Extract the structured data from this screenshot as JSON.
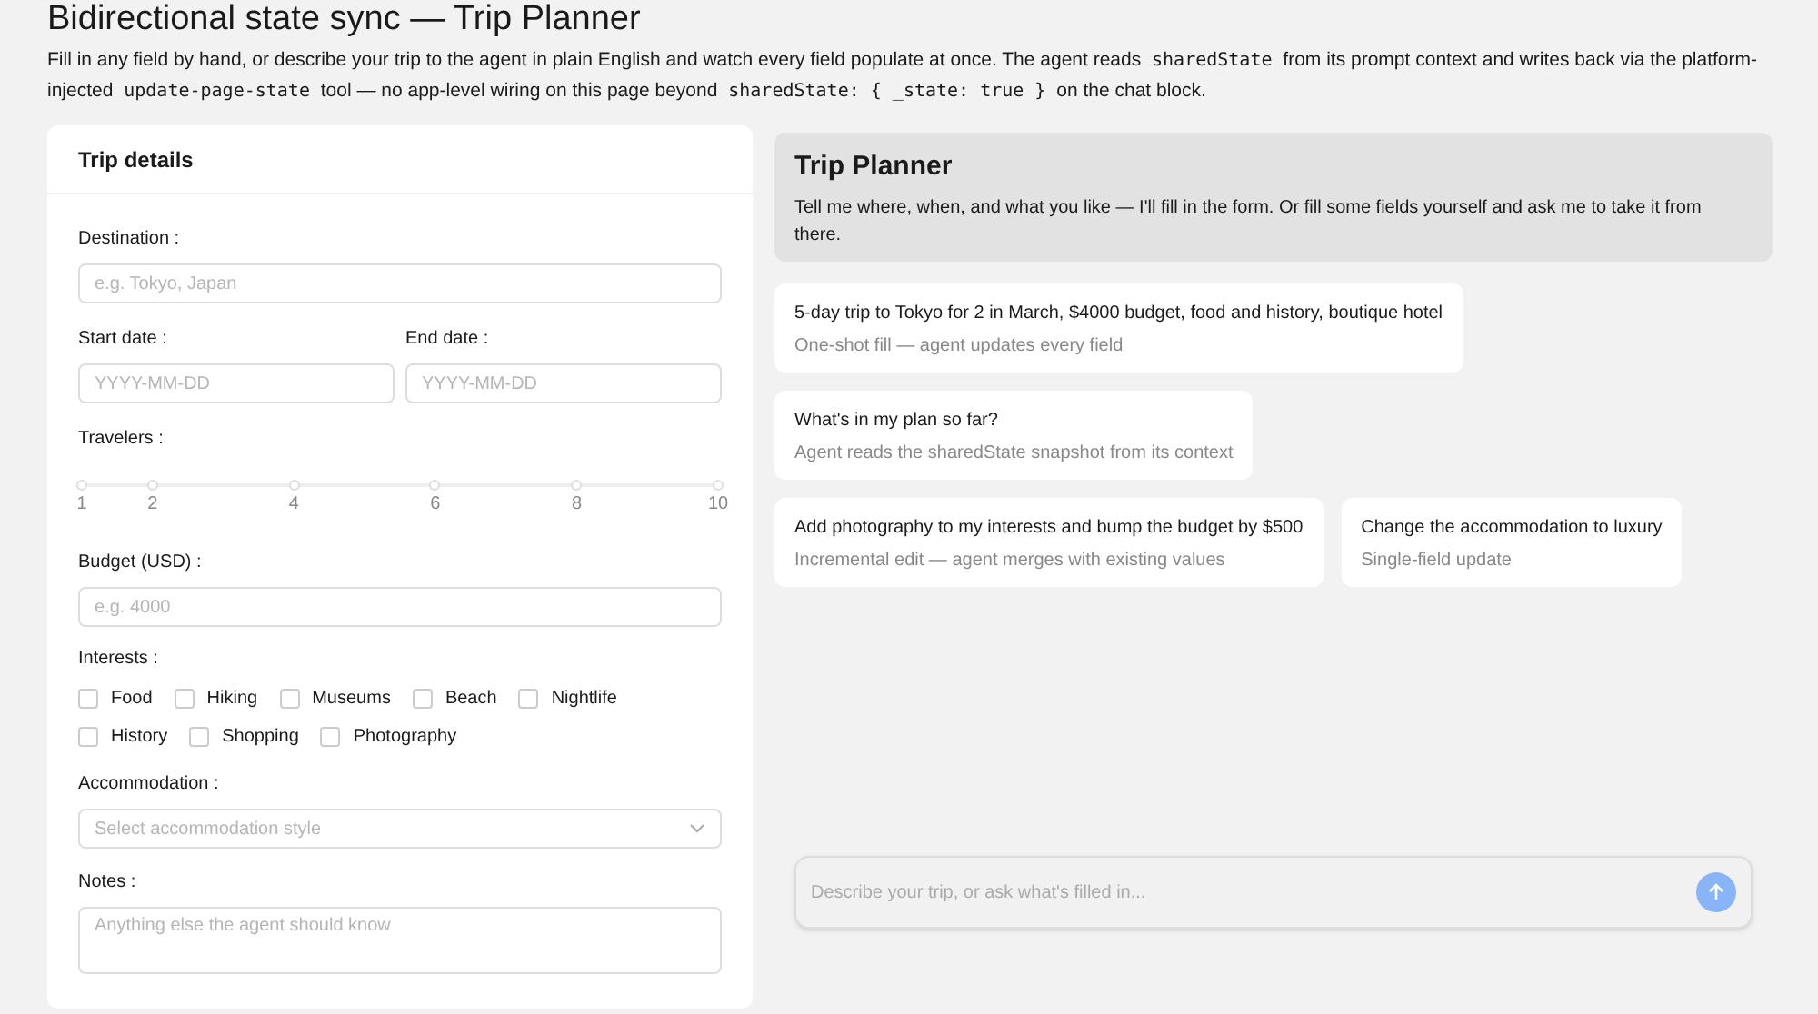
{
  "page": {
    "title": "Bidirectional state sync — Trip Planner",
    "intro_lines": [
      [
        {
          "kind": "text",
          "text": "Fill in any field by hand, or describe your trip to the agent in plain English and watch every field populate at once. The agent reads "
        },
        {
          "kind": "code",
          "text": "sharedState"
        },
        {
          "kind": "text",
          "text": " from its prompt context and writes back via the platform-"
        }
      ],
      [
        {
          "kind": "text",
          "text": "injected "
        },
        {
          "kind": "code",
          "text": "update-page-state"
        },
        {
          "kind": "text",
          "text": " tool — no app-level wiring on this page beyond "
        },
        {
          "kind": "code",
          "text": "sharedState: { _state: true }"
        },
        {
          "kind": "text",
          "text": " on the chat block."
        }
      ]
    ]
  },
  "form": {
    "title": "Trip details",
    "destination": {
      "label": "Destination :",
      "placeholder": "e.g. Tokyo, Japan"
    },
    "start_date": {
      "label": "Start date :",
      "placeholder": "YYYY-MM-DD"
    },
    "end_date": {
      "label": "End date :",
      "placeholder": "YYYY-MM-DD"
    },
    "travelers": {
      "label": "Travelers :",
      "ticks": [
        "1",
        "2",
        "4",
        "6",
        "8",
        "10"
      ]
    },
    "budget": {
      "label": "Budget (USD) :",
      "placeholder": "e.g. 4000"
    },
    "interests": {
      "label": "Interests :",
      "options": [
        {
          "label": "Food",
          "checked": false
        },
        {
          "label": "Hiking",
          "checked": false
        },
        {
          "label": "Museums",
          "checked": false
        },
        {
          "label": "Beach",
          "checked": false
        },
        {
          "label": "Nightlife",
          "checked": false
        },
        {
          "label": "History",
          "checked": false
        },
        {
          "label": "Shopping",
          "checked": false
        },
        {
          "label": "Photography",
          "checked": false
        }
      ]
    },
    "accommodation": {
      "label": "Accommodation :",
      "placeholder": "Select accommodation style"
    },
    "notes": {
      "label": "Notes :",
      "placeholder": "Anything else the agent should know"
    }
  },
  "chat": {
    "title": "Trip Planner",
    "welcome": "Tell me where, when, and what you like — I'll fill in the form. Or fill some fields yourself and ask me to take it from there.",
    "suggestion_rows": [
      [
        {
          "title": "5-day trip to Tokyo for 2 in March, $4000 budget, food and history, boutique hotel",
          "subtitle": "One-shot fill — agent updates every field"
        }
      ],
      [
        {
          "title": "What's in my plan so far?",
          "subtitle": "Agent reads the sharedState snapshot from its context"
        }
      ],
      [
        {
          "title": "Add photography to my interests and bump the budget by $500",
          "subtitle": "Incremental edit — agent merges with existing values"
        },
        {
          "title": "Change the accommodation to luxury",
          "subtitle": "Single-field update"
        }
      ]
    ],
    "input": {
      "placeholder": "Describe your trip, or ask what's filled in..."
    }
  }
}
